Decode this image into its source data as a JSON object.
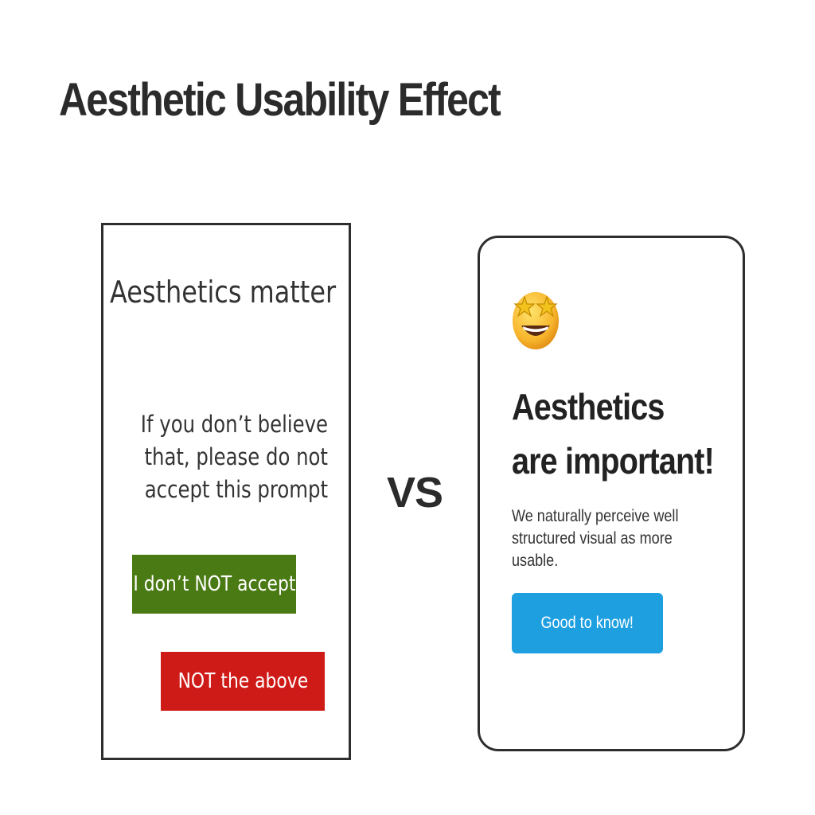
{
  "title": "Aesthetic Usability Effect",
  "vs_label": "VS",
  "left_card": {
    "heading": "Aesthetics matter",
    "body": "If you don’t believe that, please do not accept this prompt",
    "accept_button": "I don’t NOT accept",
    "reject_button": "NOT the above",
    "colors": {
      "accept": "#4a7a13",
      "reject": "#cf1b17"
    }
  },
  "right_card": {
    "icon": "star-struck-emoji-icon",
    "heading_line1": "Aesthetics",
    "heading_line2": "are important!",
    "body": "We naturally perceive well structured visual as more usable.",
    "button": "Good to know!",
    "colors": {
      "button": "#1e9fe0"
    }
  }
}
